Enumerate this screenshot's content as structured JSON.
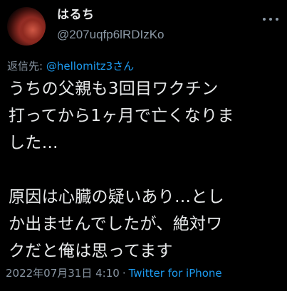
{
  "tweet": {
    "author": {
      "display_name": "はるち",
      "handle": "@207uqfp6lRDIzKo"
    },
    "reply_to": {
      "prefix": "返信先: ",
      "mention": "@hellomitz3さん"
    },
    "body_lines": [
      "うちの父親も3回目ワクチン",
      "打ってから1ヶ月で亡くなりま",
      "した…",
      "",
      "原因は心臓の疑いあり…とし",
      "か出ませんでしたが、絶対ワ",
      "クだと俺は思ってます"
    ],
    "timestamp": "2022年07月31日 4:10",
    "separator": "·",
    "source": "Twitter for iPhone"
  },
  "colors": {
    "background": "#000000",
    "primary_text": "#e7e9ea",
    "secondary_text": "#8b98a5",
    "accent": "#1d9bf0"
  },
  "icons": {
    "more": "more-horizontal-icon",
    "avatar": "avatar-red-moon-image"
  }
}
